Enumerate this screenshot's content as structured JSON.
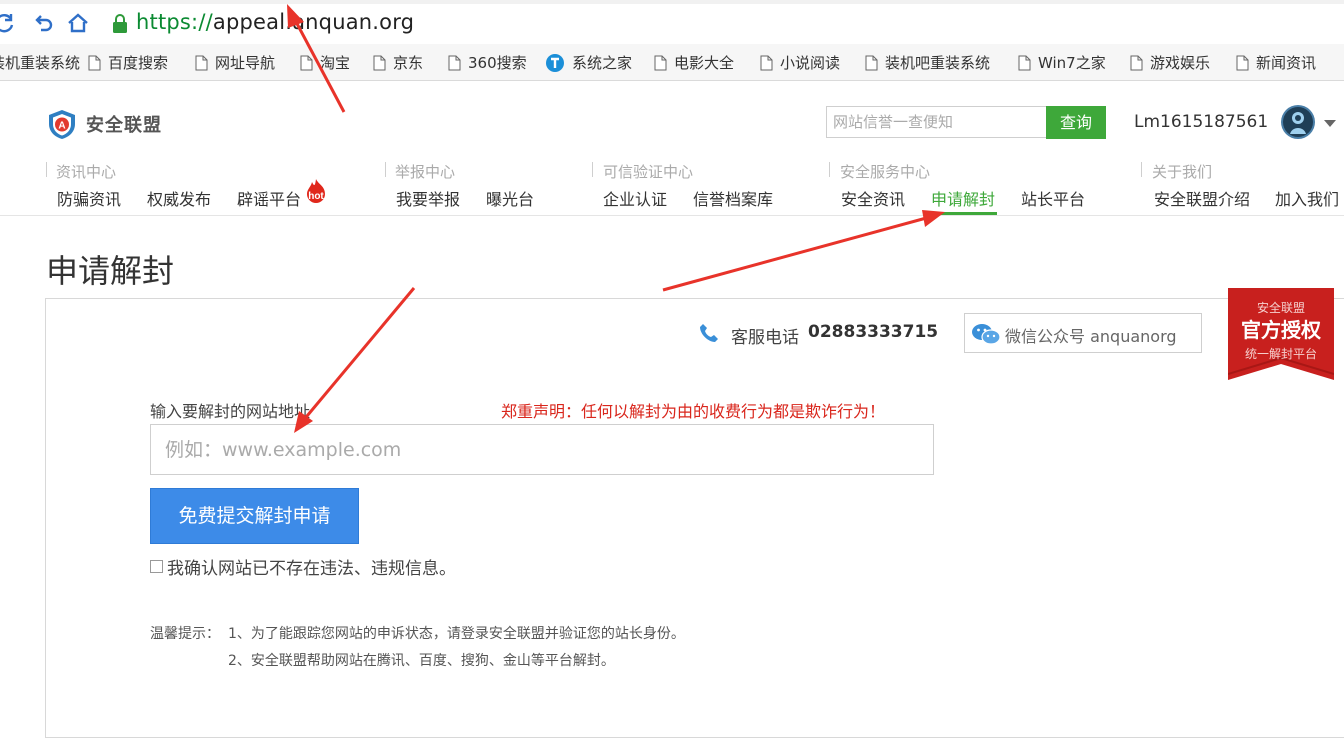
{
  "browser": {
    "url_scheme": "https://",
    "url_rest": "appeal.anquan.org",
    "bookmarks": [
      "装机重装系统",
      "百度搜索",
      "网址导航",
      "淘宝",
      "京东",
      "360搜索",
      "系统之家",
      "电影大全",
      "小说阅读",
      "装机吧重装系统",
      "Win7之家",
      "游戏娱乐",
      "新闻资讯"
    ]
  },
  "header": {
    "logo_text": "安全联盟",
    "search_placeholder": "网站信誉一查便知",
    "search_button": "查询",
    "username": "Lm1615187561"
  },
  "nav": {
    "groups": [
      {
        "label": "资讯中心",
        "items": [
          "防骗资讯",
          "权威发布",
          "辟谣平台"
        ]
      },
      {
        "label": "举报中心",
        "items": [
          "我要举报",
          "曝光台"
        ]
      },
      {
        "label": "可信验证中心",
        "items": [
          "企业认证",
          "信誉档案库"
        ]
      },
      {
        "label": "安全服务中心",
        "items": [
          "安全资讯",
          "申请解封",
          "站长平台"
        ]
      },
      {
        "label": "关于我们",
        "items": [
          "安全联盟介绍",
          "加入我们"
        ]
      }
    ],
    "hot_badge": "hot",
    "active_item": "申请解封"
  },
  "page": {
    "title": "申请解封",
    "service_label": "客服电话",
    "service_number": "02883333715",
    "wechat_text": "微信公众号 anquanorg",
    "badge": {
      "line1": "安全联盟",
      "line2": "官方授权",
      "line3": "统一解封平台"
    },
    "field_label": "输入要解封的网站地址",
    "warning": "郑重声明：任何以解封为由的收费行为都是欺诈行为！",
    "url_placeholder": "例如：www.example.com",
    "submit_button": "免费提交解封申请",
    "confirm_text": "我确认网站已不存在违法、违规信息。",
    "tip_label": "温馨提示：",
    "tips": [
      "1、为了能跟踪您网站的申诉状态，请登录安全联盟并验证您的站长身份。",
      "2、安全联盟帮助网站在腾讯、百度、搜狗、金山等平台解封。"
    ]
  },
  "colors": {
    "accent_green": "#3ea83a",
    "button_blue": "#3d8be8",
    "warning_red": "#d9261c",
    "annotation_red": "#e8332a"
  }
}
